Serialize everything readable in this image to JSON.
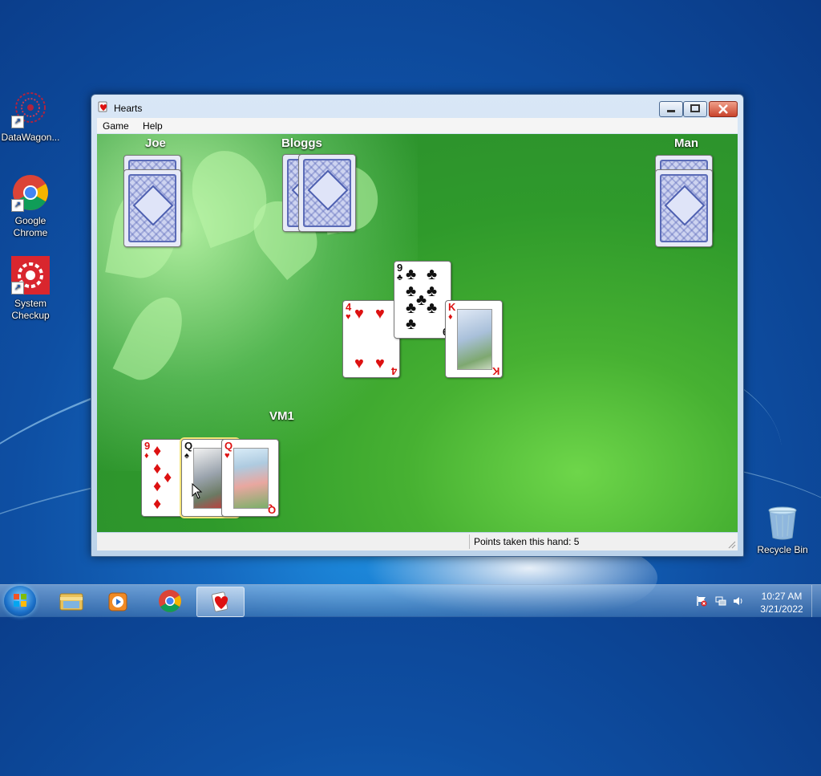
{
  "desktop": {
    "icons": [
      {
        "label": "DataWagon..."
      },
      {
        "label": "Google Chrome"
      },
      {
        "label": "System Checkup"
      },
      {
        "label": "Recycle Bin"
      }
    ]
  },
  "window": {
    "title": "Hearts",
    "menu": [
      "Game",
      "Help"
    ],
    "status": "Points taken this hand: 5"
  },
  "game": {
    "players": {
      "west": "Joe",
      "north": "Bloggs",
      "east": "Man",
      "south": "VM1"
    },
    "trick": [
      {
        "rank": "9",
        "suit": "♣",
        "color": "black",
        "by": "north"
      },
      {
        "rank": "4",
        "suit": "♥",
        "color": "red",
        "by": "west"
      },
      {
        "rank": "K",
        "suit": "♦",
        "color": "red",
        "by": "east"
      }
    ],
    "hand": [
      {
        "rank": "9",
        "suit": "♦",
        "color": "red"
      },
      {
        "rank": "Q",
        "suit": "♠",
        "color": "black",
        "selected": true
      },
      {
        "rank": "Q",
        "suit": "♥",
        "color": "red"
      }
    ]
  },
  "taskbar": {
    "time": "10:27 AM",
    "date": "3/21/2022",
    "pinned": [
      "start-orb",
      "explorer-icon",
      "media-player-icon",
      "chrome-icon",
      "hearts-icon"
    ]
  },
  "colors": {
    "felt": "#2f9a2b",
    "accent": "#1569c0"
  }
}
